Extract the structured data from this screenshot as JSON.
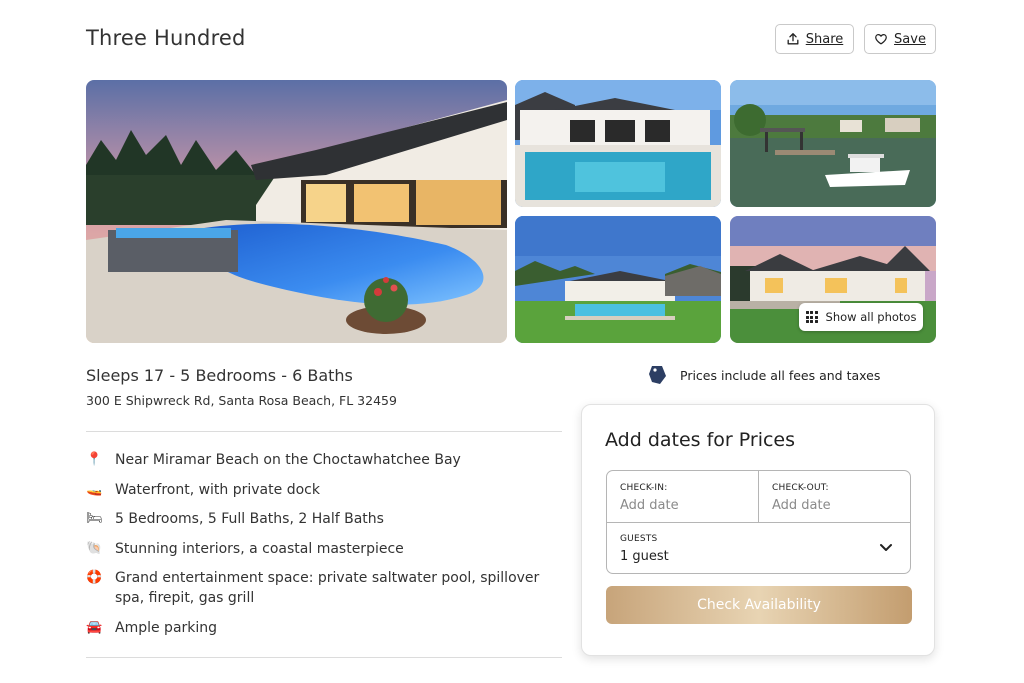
{
  "header": {
    "title": "Three Hundred",
    "share_label": "Share",
    "save_label": "Save",
    "share_icon": "upload-icon",
    "save_icon": "heart-icon"
  },
  "gallery": {
    "show_all_label": "Show all photos",
    "show_all_icon": "grid-dots-icon"
  },
  "listing": {
    "summary": "Sleeps 17 - 5 Bedrooms - 6 Baths",
    "address": "300 E Shipwreck Rd, Santa Rosa Beach, FL 32459",
    "features": [
      {
        "icon": "map-pin-icon",
        "glyph": "📍",
        "text": "Near Miramar Beach on the Choctawhatchee Bay"
      },
      {
        "icon": "boat-icon",
        "glyph": "🚤",
        "text": "Waterfront, with private dock"
      },
      {
        "icon": "bed-icon",
        "glyph": "🛏",
        "text": "5 Bedrooms, 5 Full Baths, 2 Half Baths"
      },
      {
        "icon": "shell-icon",
        "glyph": "🐚",
        "text": "Stunning interiors, a coastal masterpiece"
      },
      {
        "icon": "lifebuoy-icon",
        "glyph": "🛟",
        "text": "Grand entertainment space: private saltwater pool, spillover spa, firepit, gas grill"
      },
      {
        "icon": "car-icon",
        "glyph": "🚘",
        "text": "Ample parking"
      }
    ]
  },
  "pricing": {
    "note": "Prices include all fees and taxes",
    "note_icon": "price-tag-icon",
    "card_title": "Add dates for Prices",
    "checkin_label": "CHECK-IN:",
    "checkin_value": "Add date",
    "checkout_label": "CHECK-OUT:",
    "checkout_value": "Add date",
    "guests_label": "GUESTS",
    "guests_value": "1 guest",
    "button_label": "Check Availability"
  },
  "colors": {
    "accent_gold": "#c9a67b",
    "text": "#222222",
    "border": "#b5b5b5"
  }
}
